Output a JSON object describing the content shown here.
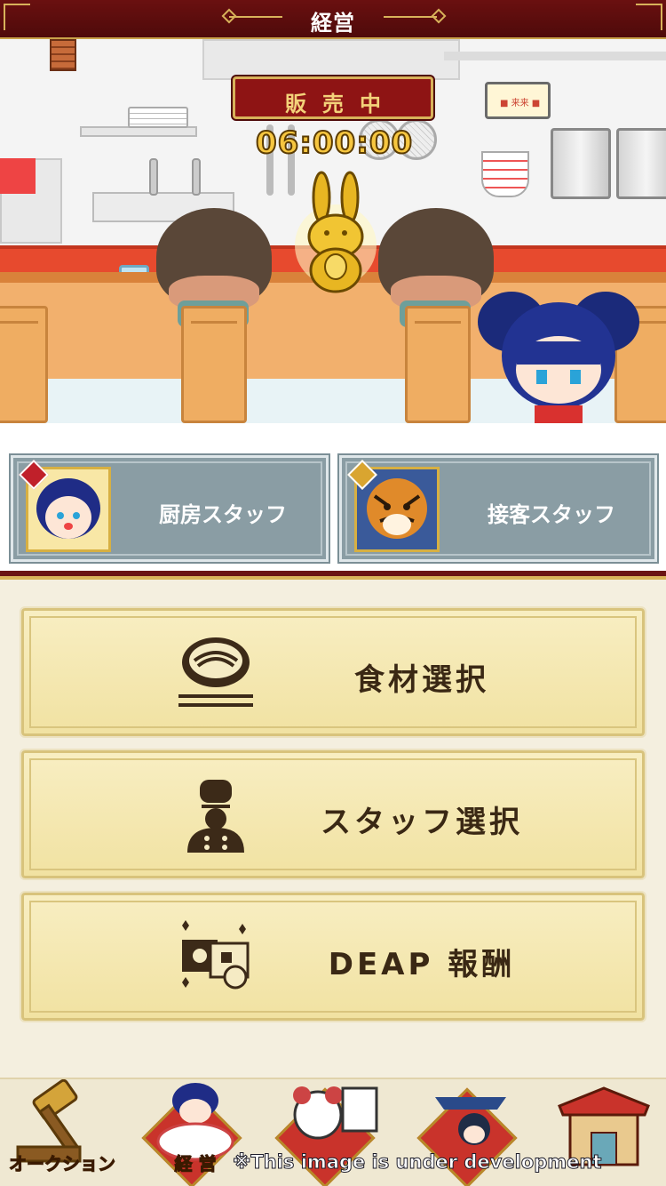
{
  "header": {
    "title": "経営"
  },
  "scene": {
    "status_label": "販売中",
    "timer": "06:00:00"
  },
  "staff": [
    {
      "label": "厨房スタッフ",
      "icon": "chef-girl-avatar"
    },
    {
      "label": "接客スタッフ",
      "icon": "tiger-avatar"
    }
  ],
  "menu": [
    {
      "label": "食材選択",
      "icon": "ramen-bowl-icon"
    },
    {
      "label": "スタッフ選択",
      "icon": "chef-icon"
    },
    {
      "label": "DEAP 報酬",
      "icon": "reward-cards-icon"
    }
  ],
  "nav": [
    {
      "label": "オークション",
      "icon": "gavel-icon"
    },
    {
      "label": "経 営",
      "icon": "ramen-girl-icon"
    },
    {
      "label": "",
      "icon": "panda-document-icon"
    },
    {
      "label": "",
      "icon": "warrior-icon"
    },
    {
      "label": "",
      "icon": "shop-icon"
    }
  ],
  "dev_note": "※This image is under development",
  "colors": {
    "header_bg": "#5a0e0e",
    "accent_gold": "#d8b25a",
    "staff_card_bg": "#8a9da4",
    "menu_btn_bg": "#f4e7b0",
    "timer_text": "#f6c640"
  }
}
